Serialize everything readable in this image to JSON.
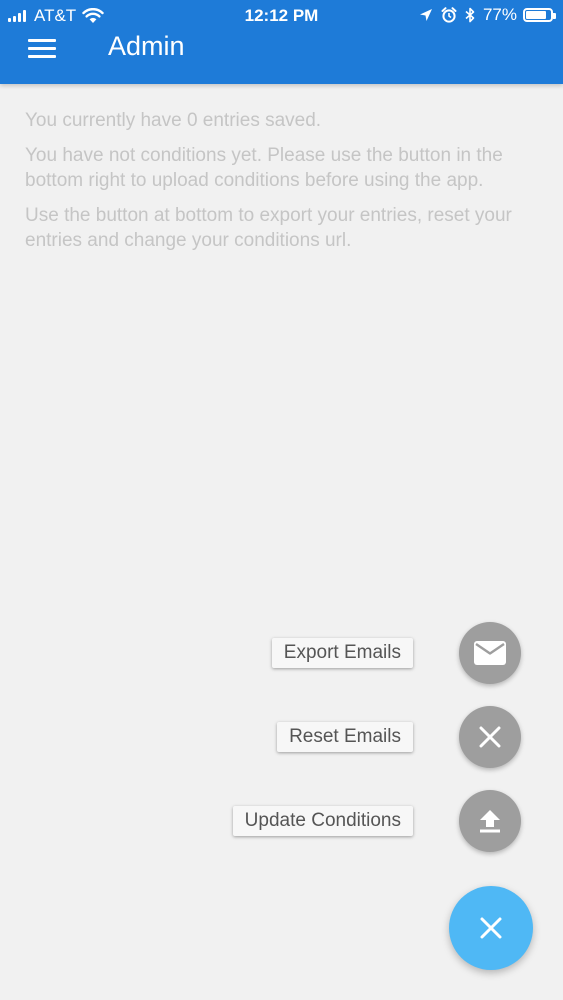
{
  "status_bar": {
    "carrier": "AT&T",
    "time": "12:12 PM",
    "battery_percent": "77%",
    "battery_level": 0.77,
    "icons": [
      "signal-icon",
      "wifi-icon",
      "location-icon",
      "alarm-icon",
      "bluetooth-icon",
      "battery-icon"
    ]
  },
  "app_bar": {
    "title": "Admin",
    "menu_icon": "hamburger-menu-icon"
  },
  "content": {
    "entries_text": "You currently have 0 entries saved.",
    "conditions_text": "You have not conditions yet. Please use the button in the bottom right to upload conditions before using the app.",
    "export_text": "Use the button at bottom to export your entries, reset your entries and change your conditions url."
  },
  "actions": [
    {
      "label": "Export Emails",
      "icon": "mail-icon"
    },
    {
      "label": "Reset Emails",
      "icon": "close-icon"
    },
    {
      "label": "Update Conditions",
      "icon": "upload-icon"
    }
  ],
  "main_fab": {
    "icon": "close-icon"
  },
  "colors": {
    "primary": "#1e7bd8",
    "fab": "#4fb8f5",
    "mini_fab": "#9e9e9e",
    "background": "#f1f1f1",
    "muted_text": "#c5c5c5"
  }
}
